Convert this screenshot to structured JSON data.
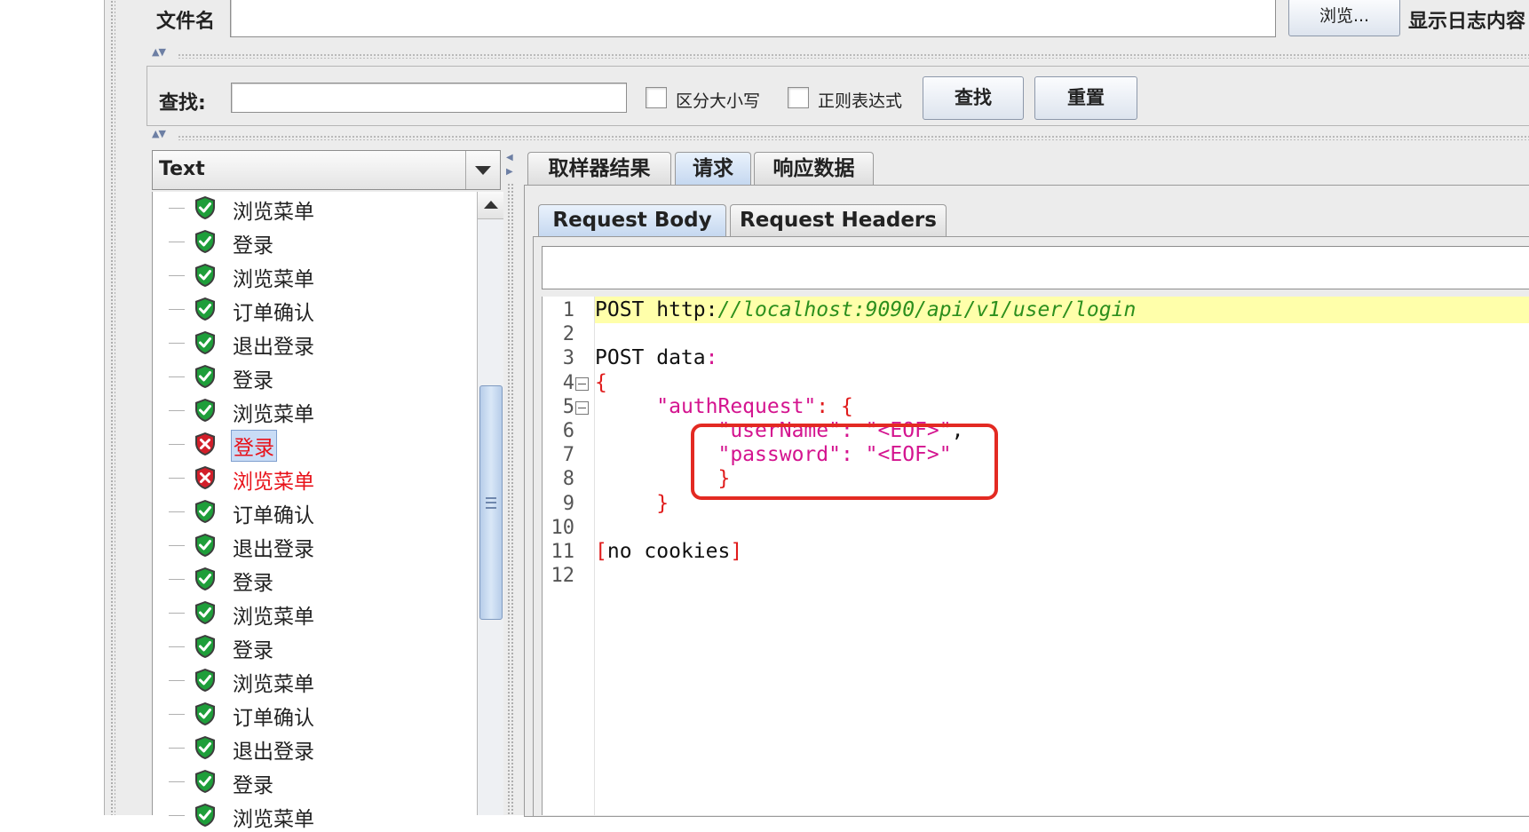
{
  "file_row": {
    "label": "文件名",
    "browse_label": "浏览...",
    "log_label": "显示日志内容"
  },
  "search_row": {
    "label": "查找:",
    "case_label": "区分大小写",
    "regex_label": "正则表达式",
    "find_label": "查找",
    "reset_label": "重置"
  },
  "renderer": {
    "selected": "Text"
  },
  "tree": {
    "items": [
      {
        "label": "浏览菜单",
        "status": "ok"
      },
      {
        "label": "登录",
        "status": "ok"
      },
      {
        "label": "浏览菜单",
        "status": "ok"
      },
      {
        "label": "订单确认",
        "status": "ok"
      },
      {
        "label": "退出登录",
        "status": "ok"
      },
      {
        "label": "登录",
        "status": "ok"
      },
      {
        "label": "浏览菜单",
        "status": "ok"
      },
      {
        "label": "登录",
        "status": "error"
      },
      {
        "label": "浏览菜单",
        "status": "error"
      },
      {
        "label": "订单确认",
        "status": "ok"
      },
      {
        "label": "退出登录",
        "status": "ok"
      },
      {
        "label": "登录",
        "status": "ok"
      },
      {
        "label": "浏览菜单",
        "status": "ok"
      },
      {
        "label": "登录",
        "status": "ok"
      },
      {
        "label": "浏览菜单",
        "status": "ok"
      },
      {
        "label": "订单确认",
        "status": "ok"
      },
      {
        "label": "退出登录",
        "status": "ok"
      },
      {
        "label": "登录",
        "status": "ok"
      },
      {
        "label": "浏览菜单",
        "status": "ok"
      }
    ],
    "selected_index": 7
  },
  "tabs": {
    "sampler": "取样器结果",
    "request": "请求",
    "response": "响应数据",
    "active": "request"
  },
  "subtabs": {
    "body": "Request Body",
    "headers": "Request Headers",
    "active": "body"
  },
  "editor": {
    "line_numbers": [
      "1",
      "2",
      "3",
      "4",
      "5",
      "6",
      "7",
      "8",
      "9",
      "10",
      "11",
      "12"
    ],
    "line1_method": "POST ",
    "line1_scheme": "http:",
    "line1_url": "//localhost:9090/api/v1/user/login",
    "line3": "POST data",
    "line3_colon": ":",
    "line4": "{",
    "line5_key": "\"authRequest\"",
    "line5_rest": ": {",
    "line6_key": "\"userName\"",
    "line6_val": "\"<EOF>\"",
    "line7_key": "\"password\"",
    "line7_val": "\"<EOF>\"",
    "line8": "}",
    "line9": "}",
    "line11_open": "[",
    "line11_text": "no cookies",
    "line11_close": "]"
  },
  "colors": {
    "ok": "#1e9e3a",
    "error": "#d21f2a",
    "highlight_box": "#e32a22",
    "selection": "#c9dcf6"
  }
}
